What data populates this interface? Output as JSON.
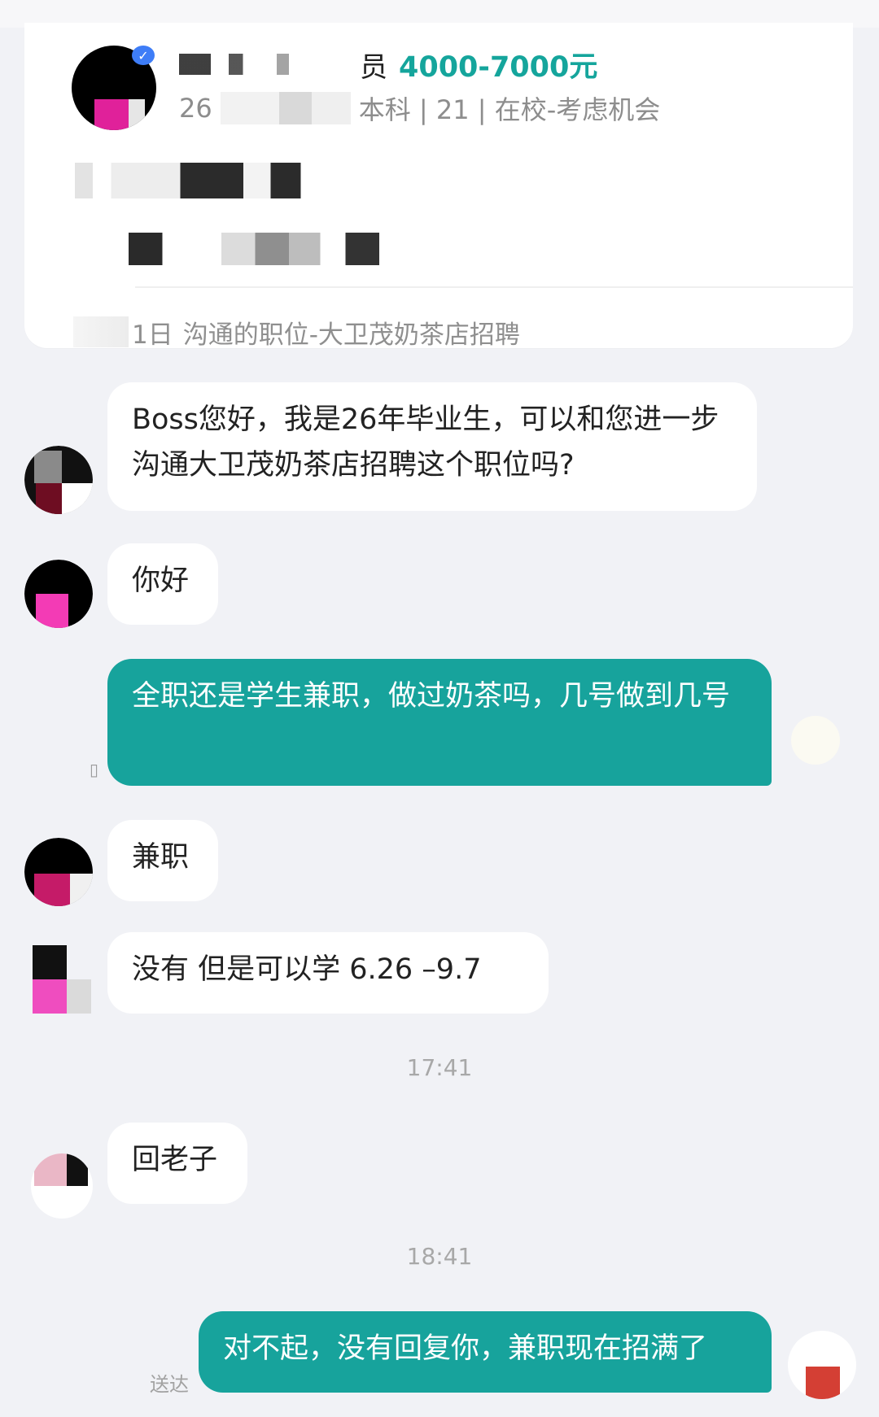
{
  "profile": {
    "name_visible_fragment": "",
    "title_fragment": "员",
    "salary": "4000-7000元",
    "meta_prefix": "26",
    "meta_suffix": "本科 | 21 | 在校-考虑机会",
    "footer_prefix": "1日",
    "footer_text": "沟通的职位-大卫茂奶茶店招聘"
  },
  "chat": {
    "messages": [
      {
        "side": "in",
        "text": "Boss您好，我是26年毕业生，可以和您进一步沟通大卫茂奶茶店招聘这个职位吗?"
      },
      {
        "side": "in",
        "text": "你好"
      },
      {
        "side": "out",
        "text": "全职还是学生兼职，做过奶茶吗，几号做到几号"
      },
      {
        "side": "in",
        "text": "兼职"
      },
      {
        "side": "in",
        "text": "没有  但是可以学   6.26 –9.7"
      },
      {
        "side": "in",
        "text": "回老子"
      },
      {
        "side": "out",
        "text": "对不起，没有回复你，兼职现在招满了"
      }
    ],
    "timestamps": [
      "17:41",
      "18:41"
    ],
    "delivery_status": "送达"
  },
  "colors": {
    "accent": "#17a39c",
    "salary": "#15a59c",
    "background": "#f1f2f6"
  }
}
